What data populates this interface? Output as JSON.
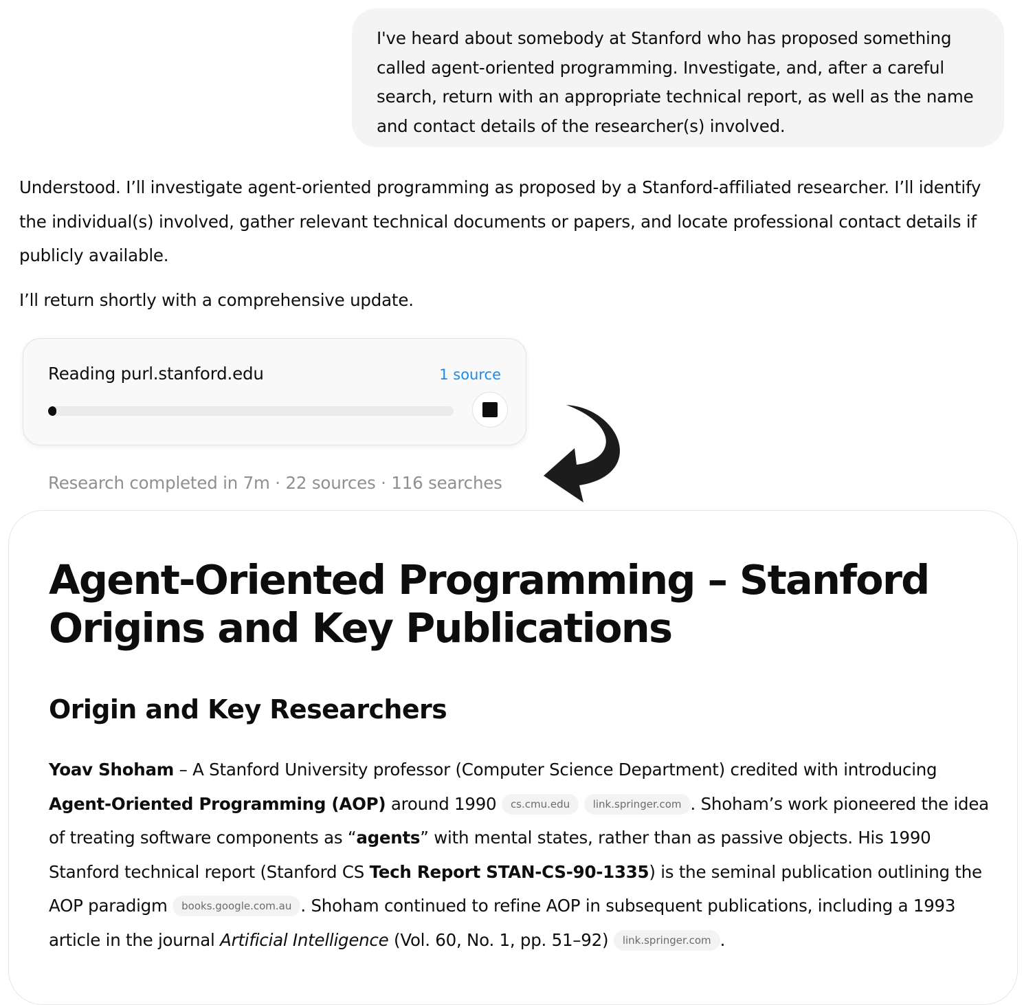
{
  "user_message": "I've heard about somebody at Stanford who has proposed something called agent-oriented programming. Investigate, and, after a careful search, return with an appropriate technical report, as well as the name and contact details of the researcher(s) involved.",
  "assistant": {
    "paragraph1": "Understood. I’ll investigate agent-oriented programming as proposed by a Stanford-affiliated researcher. I’ll identify the individual(s) involved, gather relevant technical documents or papers, and locate professional contact details if publicly available.",
    "paragraph2": "I’ll return shortly with a comprehensive update."
  },
  "progress_card": {
    "status_label": "Reading purl.stanford.edu",
    "sources_link": "1 source",
    "progress_fraction": 0.02,
    "stop_icon": "stop-square-icon"
  },
  "annotation": {
    "arrow_icon": "curved-arrow-icon"
  },
  "research_summary": "Research completed in 7m · 22 sources · 116 searches",
  "report": {
    "title": "Agent-Oriented Programming – Stanford Origins and Key Publications",
    "section_heading": "Origin and Key Researchers",
    "body": {
      "name": "Yoav Shoham",
      "t1": " – A Stanford University professor (Computer Science Department) credited with introducing ",
      "aop": "Agent-Oriented Programming (AOP)",
      "t2": " around 1990 ",
      "chip1": "cs.cmu.edu",
      "chip2": "link.springer.com",
      "t3": ". Shoham’s work pioneered the idea of treating software components as “",
      "agents": "agents",
      "t4": "” with mental states, rather than as passive objects. His 1990 Stanford technical report (Stanford CS ",
      "tech_report": "Tech Report STAN-CS-90-1335",
      "t5": ") is the seminal publication outlining the AOP paradigm ",
      "chip3": "books.google.com.au",
      "t6": ". Shoham continued to refine AOP in subsequent publications, including a 1993 article in the journal ",
      "journal": "Artificial Intelligence",
      "t7": " (Vol. 60, No. 1, pp. 51–92) ",
      "chip4": "link.springer.com",
      "t8": "."
    }
  },
  "colors": {
    "user_bubble_bg": "#f4f4f4",
    "link_blue": "#1a8bea",
    "muted_text": "#8f8f8f",
    "chip_bg": "#f3f3f3",
    "chip_text": "#6b6b6b"
  }
}
